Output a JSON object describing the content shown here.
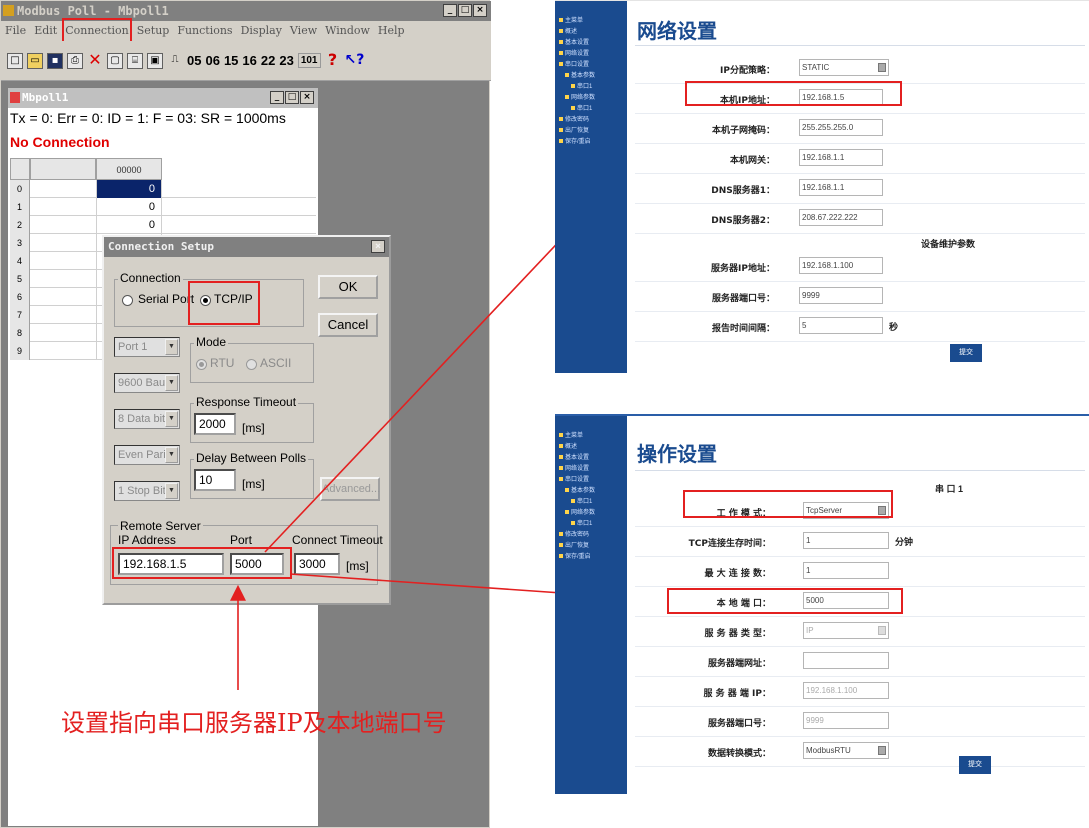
{
  "modbus_poll": {
    "title": "Modbus Poll - Mbpoll1",
    "title_buttons": [
      "_",
      "□",
      "×"
    ],
    "menu": [
      "File",
      "Edit",
      "Connection",
      "Setup",
      "Functions",
      "Display",
      "View",
      "Window",
      "Help"
    ],
    "toolbar_codes": [
      "05",
      "06",
      "15",
      "16",
      "22",
      "23",
      "101"
    ],
    "child": {
      "title": "Mbpoll1",
      "status_line": "Tx = 0: Err = 0: ID = 1: F = 03: SR = 1000ms",
      "connection_status": "No Connection",
      "col_headers": [
        "",
        "",
        "00000"
      ],
      "rows": [
        {
          "h": "0",
          "v": "0"
        },
        {
          "h": "1",
          "v": "0"
        },
        {
          "h": "2",
          "v": "0"
        },
        {
          "h": "3",
          "v": ""
        },
        {
          "h": "4",
          "v": ""
        },
        {
          "h": "5",
          "v": ""
        },
        {
          "h": "6",
          "v": ""
        },
        {
          "h": "7",
          "v": ""
        },
        {
          "h": "8",
          "v": ""
        },
        {
          "h": "9",
          "v": ""
        }
      ]
    }
  },
  "connection_setup": {
    "title": "Connection Setup",
    "close": "×",
    "connection_group": "Connection",
    "serial_port": "Serial Port",
    "tcpip": "TCP/IP",
    "ok": "OK",
    "cancel": "Cancel",
    "port": "Port 1",
    "baud": "9600 Baud",
    "data_bits": "8 Data bits",
    "parity": "Even Parity",
    "stop_bit": "1 Stop Bit",
    "mode_group": "Mode",
    "rtu": "RTU",
    "ascii": "ASCII",
    "response_timeout_group": "Response Timeout",
    "response_timeout": "2000",
    "ms": "[ms]",
    "delay_group": "Delay Between Polls",
    "delay": "10",
    "advanced": "Advanced...",
    "remote_server_group": "Remote Server",
    "ip_label": "IP Address",
    "ip_value": "192.168.1.5",
    "port_label": "Port",
    "port_value": "5000",
    "connect_timeout_label": "Connect Timeout",
    "connect_timeout_value": "3000",
    "connect_timeout_unit": "[ms]"
  },
  "caption": "设置指向串口服务器IP及本地端口号",
  "network_settings": {
    "title": "网络设置",
    "sidebar": [
      "主菜单",
      "概述",
      "基本设置",
      "网络设置",
      "串口设置",
      "基本参数",
      "串口1",
      "网络参数",
      "串口1",
      "修改密码",
      "出厂恢复",
      "保存/重启"
    ],
    "fields": [
      {
        "label": "IP分配策略：",
        "value": "STATIC",
        "type": "select"
      },
      {
        "label": "本机IP地址：",
        "value": "192.168.1.5",
        "type": "input"
      },
      {
        "label": "本机子网掩码：",
        "value": "255.255.255.0",
        "type": "input"
      },
      {
        "label": "本机网关：",
        "value": "192.168.1.1",
        "type": "input"
      },
      {
        "label": "DNS服务器1：",
        "value": "192.168.1.1",
        "type": "input"
      },
      {
        "label": "DNS服务器2：",
        "value": "208.67.222.222",
        "type": "input"
      }
    ],
    "maintenance_header": "设备维护参数",
    "fields2": [
      {
        "label": "服务器IP地址：",
        "value": "192.168.1.100"
      },
      {
        "label": "服务器端口号：",
        "value": "9999"
      },
      {
        "label": "报告时间间隔：",
        "value": "5",
        "unit": "秒"
      }
    ],
    "submit": "提交"
  },
  "operation_settings": {
    "title": "操作设置",
    "sidebar": [
      "主菜单",
      "概述",
      "基本设置",
      "网络设置",
      "串口设置",
      "基本参数",
      "串口1",
      "网络参数",
      "串口1",
      "修改密码",
      "出厂恢复",
      "保存/重启"
    ],
    "port_header": "串 口 1",
    "fields": [
      {
        "label": "工 作 模 式：",
        "value": "TcpServer",
        "type": "select"
      },
      {
        "label": "TCP连接生存时间：",
        "value": "1",
        "unit": "分钟",
        "type": "input"
      },
      {
        "label": "最 大 连 接 数：",
        "value": "1",
        "type": "input"
      },
      {
        "label": "本 地 端 口：",
        "value": "5000",
        "type": "input"
      },
      {
        "label": "服 务 器 类 型：",
        "value": "IP",
        "type": "select_dis"
      },
      {
        "label": "服务器端网址：",
        "value": "",
        "type": "input"
      },
      {
        "label": "服 务 器 端 IP：",
        "value": "192.168.1.100",
        "type": "input_dis"
      },
      {
        "label": "服务器端口号：",
        "value": "9999",
        "type": "input_dis"
      },
      {
        "label": "数据转换模式：",
        "value": "ModbusRTU",
        "type": "select"
      }
    ],
    "submit": "提交"
  },
  "colors": {
    "red": "#e32020",
    "blue": "#1a4b8f"
  }
}
